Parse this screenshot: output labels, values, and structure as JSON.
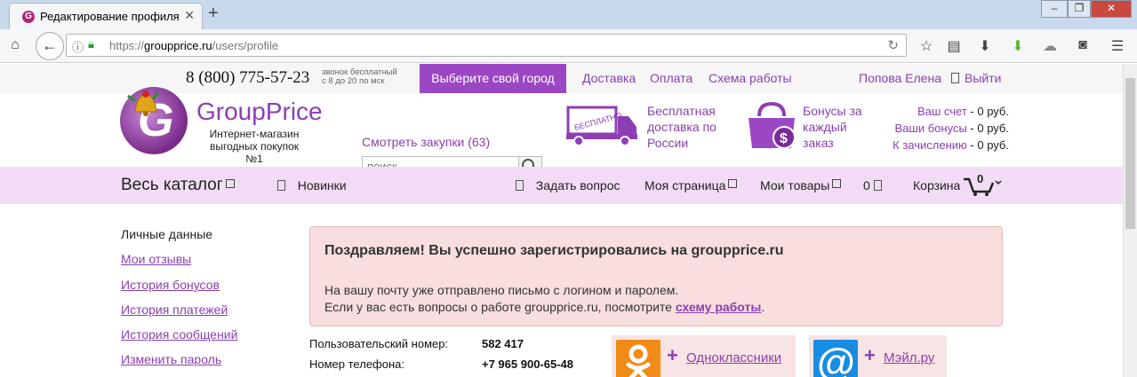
{
  "browser": {
    "tab_title": "Редактирование профиля",
    "favicon_letter": "G",
    "url_prefix": "https://",
    "url_domain": "groupprice.ru",
    "url_path": "/users/profile"
  },
  "topbar": {
    "phone": "8 (800) 775-57-23",
    "phone_note_1": "звонок бесплатный",
    "phone_note_2": "с 8 до 20 по мск",
    "city_button": "Выберите свой город",
    "links": [
      "Доставка",
      "Оплата",
      "Схема работы"
    ],
    "user_name": "Попова Елена",
    "logout": "Выйти"
  },
  "header": {
    "brand_first": "Group",
    "brand_second": "Price",
    "slogan_1": "Интернет-магазин",
    "slogan_2": "выгодных покупок №1",
    "purchases_link": "Смотреть закупки (63)",
    "search_placeholder": "поиск",
    "truck_stamp": "БЕСПЛАТНО",
    "delivery_1": "Бесплатная",
    "delivery_2": "доставка по",
    "delivery_3": "России",
    "bonus_1": "Бонусы за",
    "bonus_2": "каждый",
    "bonus_3": "заказ",
    "bonus_currency": "$",
    "account": [
      {
        "label": "Ваш счет",
        "value": "- 0 руб."
      },
      {
        "label": "Ваши бонусы",
        "value": "- 0 руб."
      },
      {
        "label": "К зачислению",
        "value": "- 0 руб."
      }
    ]
  },
  "catbar": {
    "catalog": "Весь каталог",
    "new": "Новинки",
    "ask": "Задать вопрос",
    "my_page": "Моя страница",
    "my_goods": "Мои товары",
    "count": "0",
    "cart": "Корзина",
    "cart_count": "0"
  },
  "sidebar": {
    "current": "Личные данные",
    "items": [
      "Мои отзывы",
      "История бонусов",
      "История платежей",
      "История сообщений",
      "Изменить пароль"
    ]
  },
  "alert": {
    "title": "Поздравляем! Вы успешно зарегистрировались на groupprice.ru",
    "line1": "На вашу почту уже отправлено письмо с логином и паролем.",
    "line2_prefix": "Если у вас есть вопросы о работе groupprice.ru, посмотрите ",
    "line2_link": "схему работы",
    "line2_suffix": "."
  },
  "profile": {
    "user_number_label": "Пользовательский номер:",
    "user_number": "582 417",
    "phone_label": "Номер телефона:",
    "phone": "+7 965 900-65-48"
  },
  "social": {
    "ok_label": "Одноклассники",
    "mail_label": "Мэйл.ру",
    "plus": "+"
  }
}
